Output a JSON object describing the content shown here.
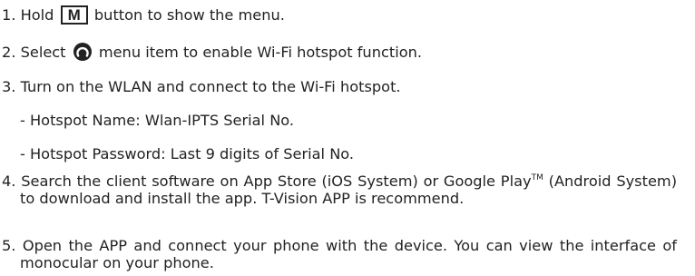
{
  "steps": {
    "s1": {
      "prefix": "1. Hold ",
      "key": "M",
      "suffix": " button to show the menu."
    },
    "s2": {
      "prefix": "2. Select ",
      "icon": "wifi-hotspot-icon",
      "suffix": " menu item to enable Wi-Fi hotspot function."
    },
    "s3": "3. Turn on the WLAN and connect to the Wi-Fi hotspot.",
    "s3_name": "- Hotspot Name: Wlan-IPTS Serial No.",
    "s3_password": "- Hotspot Password: Last 9 digits of Serial No.",
    "s4": {
      "text": "4. Search the client software on App Store (iOS System) or Google Play",
      "tm": "TM",
      "text2": " (Android System) to download and install the app. T-Vision APP is recommend."
    },
    "s5": "5. Open the APP and connect your phone with the device. You can view the interface of monocular on your phone."
  },
  "colors": {
    "text": "#222222"
  }
}
